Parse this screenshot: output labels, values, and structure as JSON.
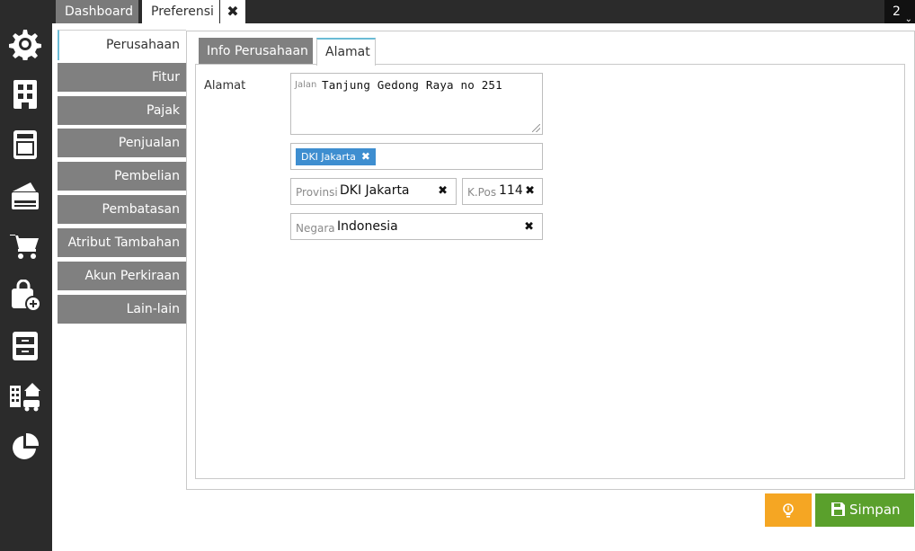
{
  "window": {
    "tabs": [
      {
        "label": "Dashboard",
        "active": false
      },
      {
        "label": "Preferensi",
        "active": true
      }
    ],
    "tab_counter": "2"
  },
  "rail": {
    "icons": [
      "settings-gear-icon",
      "building-icon",
      "ledger-book-icon",
      "cash-register-icon",
      "cart-icon",
      "shopping-bag-add-icon",
      "archive-icon",
      "city-icon",
      "pie-chart-icon"
    ]
  },
  "settings_nav": {
    "items": [
      {
        "label": "Perusahaan",
        "active": true
      },
      {
        "label": "Fitur",
        "active": false
      },
      {
        "label": "Pajak",
        "active": false
      },
      {
        "label": "Penjualan",
        "active": false
      },
      {
        "label": "Pembelian",
        "active": false
      },
      {
        "label": "Pembatasan",
        "active": false
      },
      {
        "label": "Atribut Tambahan",
        "active": false
      },
      {
        "label": "Akun Perkiraan",
        "active": false
      },
      {
        "label": "Lain-lain",
        "active": false
      }
    ]
  },
  "inner_tabs": [
    {
      "label": "Info Perusahaan",
      "active": false
    },
    {
      "label": "Alamat",
      "active": true
    }
  ],
  "address": {
    "section_label": "Alamat",
    "street_label": "Jalan",
    "street_value": "Tanjung Gedong Raya no 251",
    "tag": "DKI Jakarta",
    "province_label": "Provinsi",
    "province_value": "DKI Jakarta",
    "postal_label": "K.Pos",
    "postal_value": "114",
    "country_label": "Negara",
    "country_value": "Indonesia"
  },
  "actions": {
    "save_label": "Simpan"
  },
  "colors": {
    "rail": "#2b2b2b",
    "nav_item": "#808080",
    "accent": "#6bbcd6",
    "tag": "#3e8ed0",
    "hint_button": "#f5a623",
    "save_button": "#5aa02c"
  }
}
